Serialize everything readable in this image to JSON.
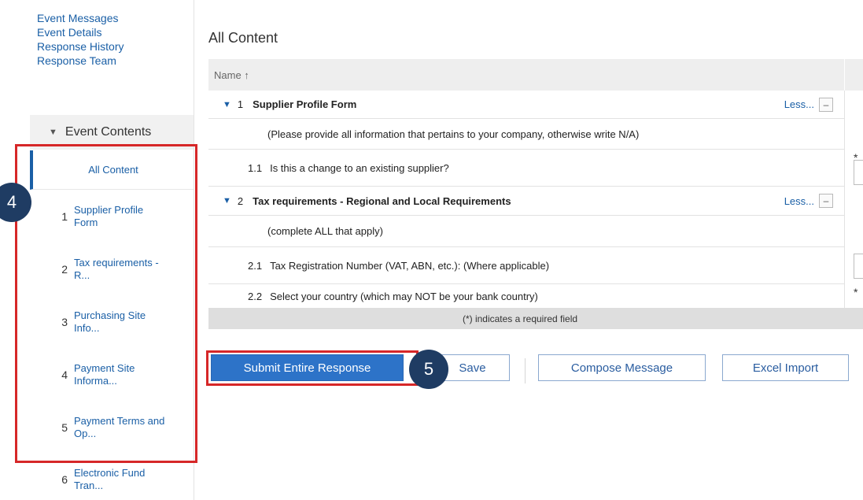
{
  "left_links": [
    "Event Messages",
    "Event Details",
    "Response History",
    "Response Team"
  ],
  "contents": {
    "header": "Event Contents",
    "all_label": "All Content",
    "items": [
      {
        "num": "1",
        "label_line1": "Supplier Profile",
        "label_line2": "Form"
      },
      {
        "num": "2",
        "label_line1": "Tax requirements -",
        "label_line2": "R..."
      },
      {
        "num": "3",
        "label_line1": "Purchasing Site",
        "label_line2": "Info..."
      },
      {
        "num": "4",
        "label_line1": "Payment Site",
        "label_line2": "Informa..."
      },
      {
        "num": "5",
        "label_line1": "Payment Terms and",
        "label_line2": "Op..."
      },
      {
        "num": "6",
        "label_line1": "Electronic Fund",
        "label_line2": "Tran..."
      }
    ]
  },
  "callouts": {
    "left": "4",
    "submit": "5"
  },
  "main": {
    "title": "All Content",
    "column_name": "Name ↑",
    "rows": {
      "s1_num": "1",
      "s1_title": "Supplier Profile Form",
      "s1_less": "Less...",
      "s1_note": "(Please provide all information that pertains to your company, otherwise write N/A)",
      "q11_num": "1.1",
      "q11_text": "Is this a change to an existing supplier?",
      "s2_num": "2",
      "s2_title": "Tax requirements - Regional and Local Requirements",
      "s2_less": "Less...",
      "s2_note": "(complete ALL that apply)",
      "q21_num": "2.1",
      "q21_text": "Tax Registration Number (VAT, ABN, etc.): (Where applicable)",
      "q22_num": "2.2",
      "q22_text": "Select your country (which may NOT be your bank country)"
    },
    "required_star": "*",
    "footer_note": "(*) indicates a required field"
  },
  "buttons": {
    "submit": "Submit Entire Response",
    "save": "Save",
    "compose": "Compose Message",
    "excel": "Excel Import"
  },
  "colors": {
    "accent": "#2d73c8",
    "highlight_border": "#d62728",
    "callout_bg": "#1f3c63"
  }
}
